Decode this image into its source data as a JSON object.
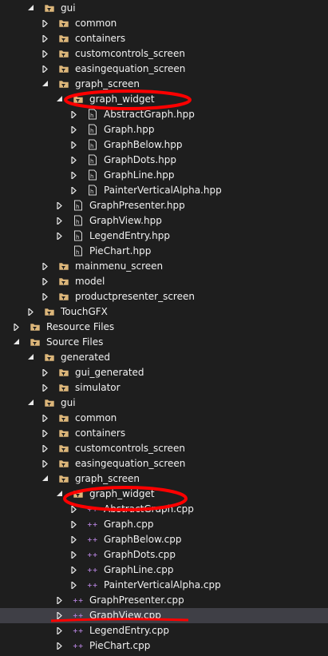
{
  "tree": [
    {
      "label": "gui",
      "depth": 2,
      "icon": "folder-filter-icon",
      "expand": "expanded"
    },
    {
      "label": "common",
      "depth": 3,
      "icon": "folder-filter-icon",
      "expand": "collapsed"
    },
    {
      "label": "containers",
      "depth": 3,
      "icon": "folder-filter-icon",
      "expand": "collapsed"
    },
    {
      "label": "customcontrols_screen",
      "depth": 3,
      "icon": "folder-filter-icon",
      "expand": "collapsed"
    },
    {
      "label": "easingequation_screen",
      "depth": 3,
      "icon": "folder-filter-icon",
      "expand": "collapsed"
    },
    {
      "label": "graph_screen",
      "depth": 3,
      "icon": "folder-filter-icon",
      "expand": "expanded"
    },
    {
      "label": "graph_widget",
      "depth": 4,
      "icon": "folder-filter-icon",
      "expand": "expanded"
    },
    {
      "label": "AbstractGraph.hpp",
      "depth": 5,
      "icon": "header-file-icon",
      "expand": "collapsed"
    },
    {
      "label": "Graph.hpp",
      "depth": 5,
      "icon": "header-file-icon",
      "expand": "collapsed"
    },
    {
      "label": "GraphBelow.hpp",
      "depth": 5,
      "icon": "header-file-icon",
      "expand": "collapsed"
    },
    {
      "label": "GraphDots.hpp",
      "depth": 5,
      "icon": "header-file-icon",
      "expand": "collapsed"
    },
    {
      "label": "GraphLine.hpp",
      "depth": 5,
      "icon": "header-file-icon",
      "expand": "collapsed"
    },
    {
      "label": "PainterVerticalAlpha.hpp",
      "depth": 5,
      "icon": "header-file-icon",
      "expand": "collapsed"
    },
    {
      "label": "GraphPresenter.hpp",
      "depth": 4,
      "icon": "header-file-icon",
      "expand": "collapsed"
    },
    {
      "label": "GraphView.hpp",
      "depth": 4,
      "icon": "header-file-icon",
      "expand": "collapsed"
    },
    {
      "label": "LegendEntry.hpp",
      "depth": 4,
      "icon": "header-file-icon",
      "expand": "collapsed"
    },
    {
      "label": "PieChart.hpp",
      "depth": 4,
      "icon": "header-file-icon",
      "expand": "none"
    },
    {
      "label": "mainmenu_screen",
      "depth": 3,
      "icon": "folder-filter-icon",
      "expand": "collapsed"
    },
    {
      "label": "model",
      "depth": 3,
      "icon": "folder-filter-icon",
      "expand": "collapsed"
    },
    {
      "label": "productpresenter_screen",
      "depth": 3,
      "icon": "folder-filter-icon",
      "expand": "collapsed"
    },
    {
      "label": "TouchGFX",
      "depth": 2,
      "icon": "folder-filter-icon",
      "expand": "collapsed"
    },
    {
      "label": "Resource Files",
      "depth": 1,
      "icon": "folder-filter-icon",
      "expand": "collapsed"
    },
    {
      "label": "Source Files",
      "depth": 1,
      "icon": "folder-filter-icon",
      "expand": "expanded"
    },
    {
      "label": "generated",
      "depth": 2,
      "icon": "folder-filter-icon",
      "expand": "expanded"
    },
    {
      "label": "gui_generated",
      "depth": 3,
      "icon": "folder-filter-icon",
      "expand": "collapsed"
    },
    {
      "label": "simulator",
      "depth": 3,
      "icon": "folder-filter-icon",
      "expand": "collapsed"
    },
    {
      "label": "gui",
      "depth": 2,
      "icon": "folder-filter-icon",
      "expand": "expanded"
    },
    {
      "label": "common",
      "depth": 3,
      "icon": "folder-filter-icon",
      "expand": "collapsed"
    },
    {
      "label": "containers",
      "depth": 3,
      "icon": "folder-filter-icon",
      "expand": "collapsed"
    },
    {
      "label": "customcontrols_screen",
      "depth": 3,
      "icon": "folder-filter-icon",
      "expand": "collapsed"
    },
    {
      "label": "easingequation_screen",
      "depth": 3,
      "icon": "folder-filter-icon",
      "expand": "collapsed"
    },
    {
      "label": "graph_screen",
      "depth": 3,
      "icon": "folder-filter-icon",
      "expand": "expanded"
    },
    {
      "label": "graph_widget",
      "depth": 4,
      "icon": "folder-filter-icon",
      "expand": "expanded"
    },
    {
      "label": "AbstractGraph.cpp",
      "depth": 5,
      "icon": "cpp-file-icon",
      "expand": "collapsed"
    },
    {
      "label": "Graph.cpp",
      "depth": 5,
      "icon": "cpp-file-icon",
      "expand": "collapsed"
    },
    {
      "label": "GraphBelow.cpp",
      "depth": 5,
      "icon": "cpp-file-icon",
      "expand": "collapsed"
    },
    {
      "label": "GraphDots.cpp",
      "depth": 5,
      "icon": "cpp-file-icon",
      "expand": "collapsed"
    },
    {
      "label": "GraphLine.cpp",
      "depth": 5,
      "icon": "cpp-file-icon",
      "expand": "collapsed"
    },
    {
      "label": "PainterVerticalAlpha.cpp",
      "depth": 5,
      "icon": "cpp-file-icon",
      "expand": "collapsed"
    },
    {
      "label": "GraphPresenter.cpp",
      "depth": 4,
      "icon": "cpp-file-icon",
      "expand": "collapsed"
    },
    {
      "label": "GraphView.cpp",
      "depth": 4,
      "icon": "cpp-file-icon",
      "expand": "collapsed",
      "selected": true
    },
    {
      "label": "LegendEntry.cpp",
      "depth": 4,
      "icon": "cpp-file-icon",
      "expand": "collapsed"
    },
    {
      "label": "PieChart.cpp",
      "depth": 4,
      "icon": "cpp-file-icon",
      "expand": "collapsed"
    }
  ],
  "colors": {
    "background": "#1e1e1e",
    "selected_row": "#3f3f46",
    "text": "#f1f1f1",
    "folder": "#dcb67a",
    "cpp_icon": "#b180d7",
    "annotation": "#ff0000"
  }
}
